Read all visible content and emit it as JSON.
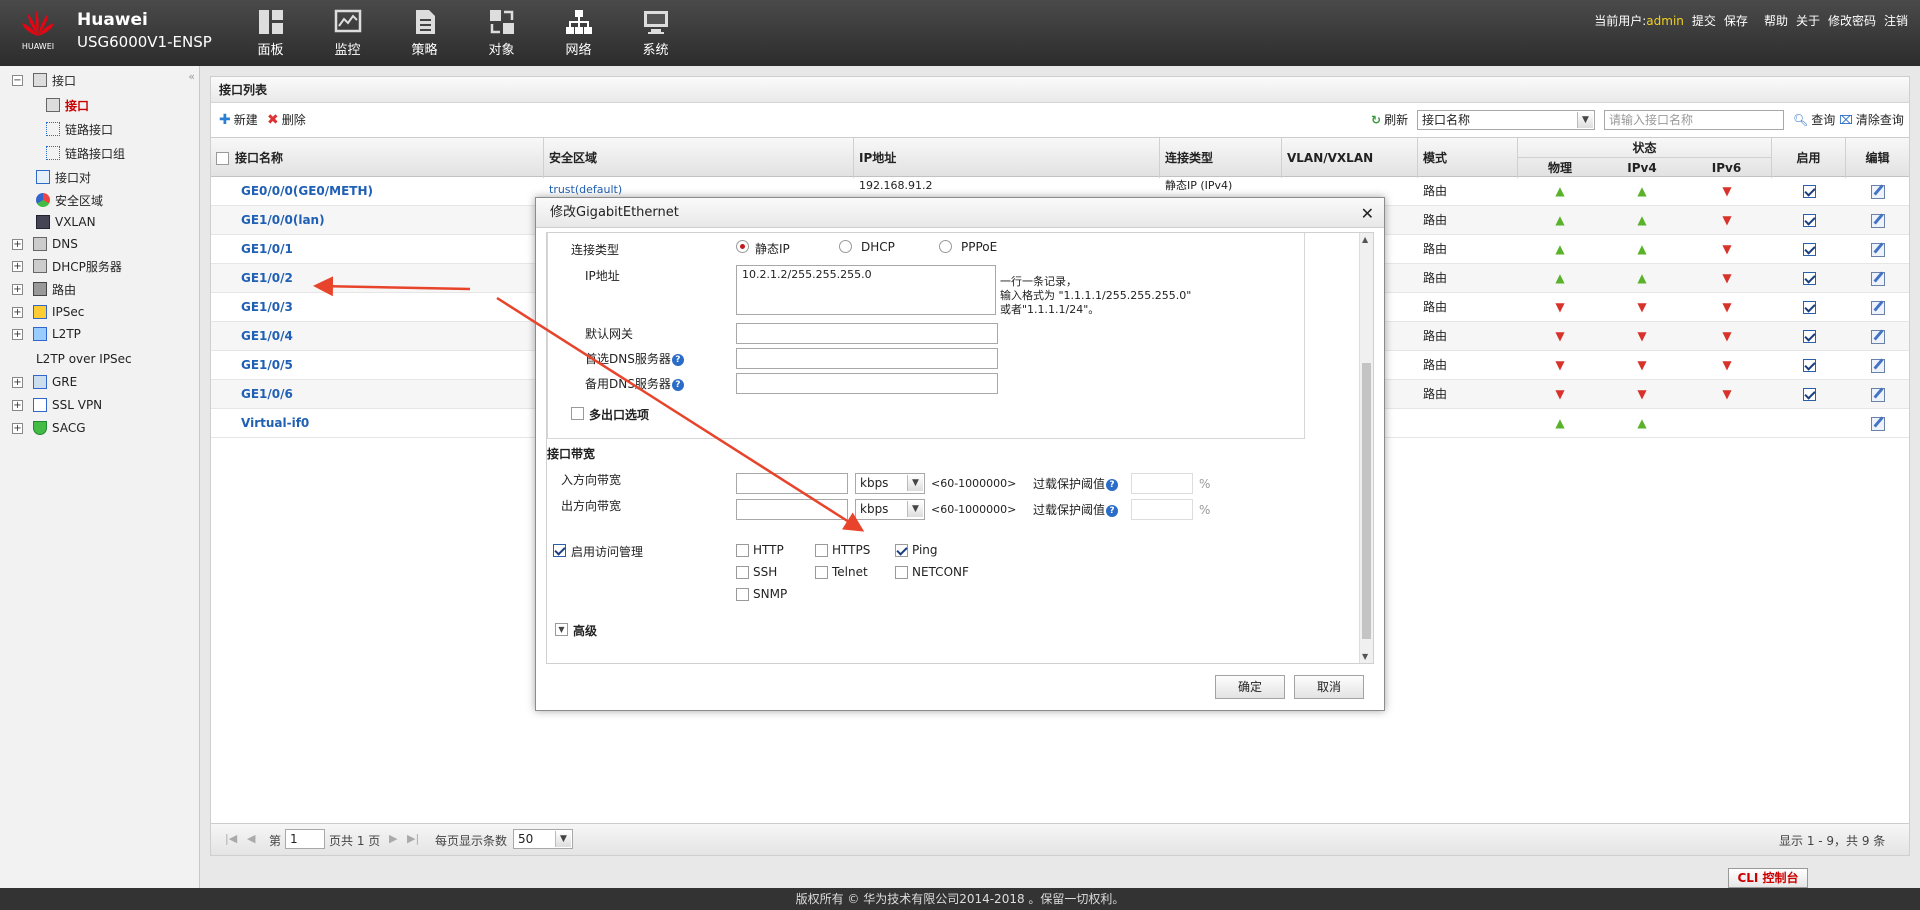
{
  "header": {
    "logo_text": "HUAWEI",
    "brand": "Huawei",
    "device": "USG6000V1-ENSP",
    "nav": [
      {
        "label": "面板",
        "icon": "dashboard-icon"
      },
      {
        "label": "监控",
        "icon": "monitor-icon"
      },
      {
        "label": "策略",
        "icon": "policy-icon"
      },
      {
        "label": "对象",
        "icon": "object-icon"
      },
      {
        "label": "网络",
        "icon": "network-icon"
      },
      {
        "label": "系统",
        "icon": "system-icon"
      }
    ],
    "user_label": "当前用户:",
    "user": "admin",
    "links": [
      "提交",
      "保存",
      "帮助",
      "关于",
      "修改密码",
      "注销"
    ]
  },
  "sidebar": {
    "items": [
      {
        "label": "接口",
        "expand": "−"
      },
      {
        "label": "接口"
      },
      {
        "label": "链路接口"
      },
      {
        "label": "链路接口组"
      },
      {
        "label": "接口对"
      },
      {
        "label": "安全区域"
      },
      {
        "label": "VXLAN"
      },
      {
        "label": "DNS",
        "expand": "+"
      },
      {
        "label": "DHCP服务器",
        "expand": "+"
      },
      {
        "label": "路由",
        "expand": "+"
      },
      {
        "label": "IPSec",
        "expand": "+"
      },
      {
        "label": "L2TP",
        "expand": "+"
      },
      {
        "label": "L2TP over IPSec"
      },
      {
        "label": "GRE",
        "expand": "+"
      },
      {
        "label": "SSL VPN",
        "expand": "+"
      },
      {
        "label": "SACG",
        "expand": "+"
      }
    ]
  },
  "panel": {
    "title": "接口列表",
    "new_label": "新建",
    "delete_label": "删除",
    "refresh_label": "刷新",
    "filter_field": "接口名称",
    "filter_placeholder": "请输入接口名称",
    "query_label": "查询",
    "clear_label": "清除查询"
  },
  "grid": {
    "headers": {
      "name": "接口名称",
      "zone": "安全区域",
      "ip": "IP地址",
      "conn": "连接类型",
      "vlan": "VLAN/VXLAN",
      "mode": "模式",
      "status": "状态",
      "phys": "物理",
      "ipv4": "IPv4",
      "ipv6": "IPv6",
      "enable": "启用",
      "edit": "编辑"
    },
    "rows": [
      {
        "name": "GE0/0/0(GE0/METH)",
        "zone": "trust(",
        "zone_sub": "default)",
        "ip": "192.168.91.2",
        "conn": "静态IP (IPv4)",
        "mode": "路由",
        "phys": "up",
        "ipv4": "up",
        "ipv6": "down",
        "enabled": true
      },
      {
        "name": "GE1/0/0(lan)",
        "zone": "",
        "ip": "",
        "conn": "",
        "mode": "路由",
        "phys": "up",
        "ipv4": "up",
        "ipv6": "down",
        "enabled": true
      },
      {
        "name": "GE1/0/1",
        "zone": "",
        "ip": "",
        "conn": "",
        "mode": "路由",
        "phys": "up",
        "ipv4": "up",
        "ipv6": "down",
        "enabled": true
      },
      {
        "name": "GE1/0/2",
        "zone": "",
        "ip": "",
        "conn": "",
        "mode": "路由",
        "phys": "up",
        "ipv4": "up",
        "ipv6": "down",
        "enabled": true
      },
      {
        "name": "GE1/0/3",
        "zone": "",
        "ip": "",
        "conn": "",
        "mode": "路由",
        "phys": "down",
        "ipv4": "down",
        "ipv6": "down",
        "enabled": true
      },
      {
        "name": "GE1/0/4",
        "zone": "",
        "ip": "",
        "conn": "",
        "mode": "路由",
        "phys": "down",
        "ipv4": "down",
        "ipv6": "down",
        "enabled": true
      },
      {
        "name": "GE1/0/5",
        "zone": "",
        "ip": "",
        "conn": "",
        "mode": "路由",
        "phys": "down",
        "ipv4": "down",
        "ipv6": "down",
        "enabled": true
      },
      {
        "name": "GE1/0/6",
        "zone": "",
        "ip": "",
        "conn": "",
        "mode": "路由",
        "phys": "down",
        "ipv4": "down",
        "ipv6": "down",
        "enabled": true
      },
      {
        "name": "Virtual-if0",
        "zone": "",
        "ip": "",
        "conn": "",
        "mode": "",
        "phys": "up",
        "ipv4": "up",
        "ipv6": "",
        "enabled": false
      }
    ]
  },
  "pager": {
    "page_prefix": "第",
    "page": "1",
    "page_suffix": "页共 1 页",
    "per_page_label": "每页显示条数",
    "per_page": "50",
    "summary": "显示 1 - 9，共 9 条"
  },
  "dialog": {
    "title": "修改GigabitEthernet",
    "conn_type_label": "连接类型",
    "conn_options": [
      "静态IP",
      "DHCP",
      "PPPoE"
    ],
    "ip_label": "IP地址",
    "ip_value": "10.2.1.2/255.255.255.0",
    "ip_hint": [
      "一行一条记录，",
      "输入格式为 \"1.1.1.1/255.255.255.0\"",
      "或者\"1.1.1.1/24\"。"
    ],
    "gateway_label": "默认网关",
    "dns1_label": "首选DNS服务器",
    "dns2_label": "备用DNS服务器",
    "multi_exit_label": "多出口选项",
    "bandwidth_title": "接口带宽",
    "in_bw_label": "入方向带宽",
    "out_bw_label": "出方向带宽",
    "unit": "kbps",
    "range": "<60-1000000>",
    "overload_label": "过载保护阈值",
    "percent": "%",
    "access_mgmt_label": "启用访问管理",
    "services": [
      {
        "label": "HTTP",
        "checked": false
      },
      {
        "label": "HTTPS",
        "checked": false
      },
      {
        "label": "Ping",
        "checked": true
      },
      {
        "label": "SSH",
        "checked": false
      },
      {
        "label": "Telnet",
        "checked": false
      },
      {
        "label": "NETCONF",
        "checked": false
      },
      {
        "label": "SNMP",
        "checked": false
      }
    ],
    "advanced_label": "高级",
    "ok_label": "确定",
    "cancel_label": "取消"
  },
  "footer": {
    "copyright": "版权所有 © 华为技术有限公司2014-2018 。保留一切权利。",
    "cli_label": "CLI 控制台"
  },
  "colors": {
    "link": "#1f5fb4",
    "status_up": "#59b22a",
    "status_down": "#d8332b",
    "annotation_arrow": "#e8432b",
    "brand_red": "#e30613"
  }
}
